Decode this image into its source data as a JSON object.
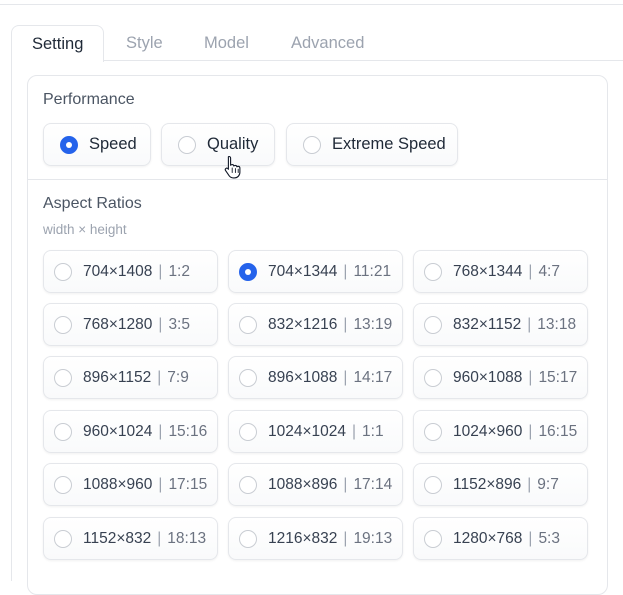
{
  "tabs": [
    {
      "label": "Setting",
      "active": true
    },
    {
      "label": "Style",
      "active": false
    },
    {
      "label": "Model",
      "active": false
    },
    {
      "label": "Advanced",
      "active": false
    }
  ],
  "performance": {
    "label": "Performance",
    "options": [
      {
        "label": "Speed",
        "selected": true
      },
      {
        "label": "Quality",
        "selected": false
      },
      {
        "label": "Extreme Speed",
        "selected": false
      }
    ]
  },
  "aspect_ratios": {
    "label": "Aspect Ratios",
    "sublabel": "width × height",
    "options": [
      {
        "size": "704×1408",
        "ratio": "1:2",
        "selected": false
      },
      {
        "size": "704×1344",
        "ratio": "11:21",
        "selected": true
      },
      {
        "size": "768×1344",
        "ratio": "4:7",
        "selected": false
      },
      {
        "size": "768×1280",
        "ratio": "3:5",
        "selected": false
      },
      {
        "size": "832×1216",
        "ratio": "13:19",
        "selected": false
      },
      {
        "size": "832×1152",
        "ratio": "13:18",
        "selected": false
      },
      {
        "size": "896×1152",
        "ratio": "7:9",
        "selected": false
      },
      {
        "size": "896×1088",
        "ratio": "14:17",
        "selected": false
      },
      {
        "size": "960×1088",
        "ratio": "15:17",
        "selected": false
      },
      {
        "size": "960×1024",
        "ratio": "15:16",
        "selected": false
      },
      {
        "size": "1024×1024",
        "ratio": "1:1",
        "selected": false
      },
      {
        "size": "1024×960",
        "ratio": "16:15",
        "selected": false
      },
      {
        "size": "1088×960",
        "ratio": "17:15",
        "selected": false
      },
      {
        "size": "1088×896",
        "ratio": "17:14",
        "selected": false
      },
      {
        "size": "1152×896",
        "ratio": "9:7",
        "selected": false
      },
      {
        "size": "1152×832",
        "ratio": "18:13",
        "selected": false
      },
      {
        "size": "1216×832",
        "ratio": "19:13",
        "selected": false
      },
      {
        "size": "1280×768",
        "ratio": "5:3",
        "selected": false
      }
    ]
  },
  "colors": {
    "accent": "#2563eb",
    "border": "#e5e7eb"
  },
  "icons": {
    "radio_selected": "radio-selected-icon",
    "radio_unselected": "radio-unselected-icon",
    "cursor": "hand-pointer-icon"
  }
}
